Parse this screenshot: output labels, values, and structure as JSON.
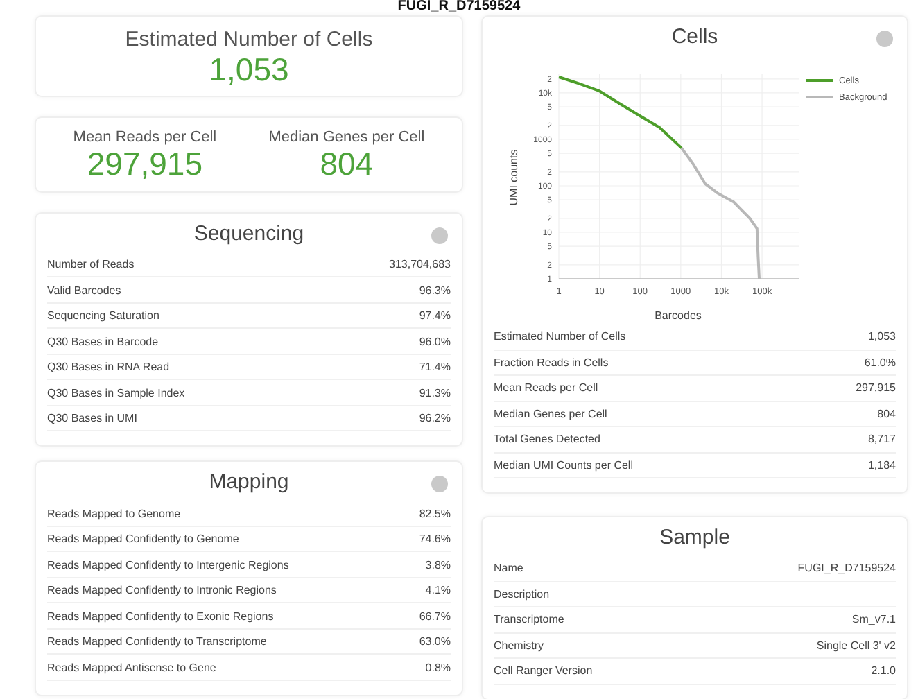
{
  "title": "FUGI_R_D7159524",
  "left_column": [
    {
      "kind": "metrics",
      "help": false,
      "metrics": [
        {
          "label": "Estimated Number of Cells",
          "value": "1,053"
        }
      ]
    },
    {
      "kind": "metrics",
      "help": false,
      "metrics": [
        {
          "label": "Mean Reads per Cell",
          "value": "297,915"
        },
        {
          "label": "Median Genes per Cell",
          "value": "804"
        }
      ]
    },
    {
      "kind": "table",
      "title": "Sequencing",
      "help": true,
      "rows": [
        {
          "label": "Number of Reads",
          "value": "313,704,683"
        },
        {
          "label": "Valid Barcodes",
          "value": "96.3%"
        },
        {
          "label": "Sequencing Saturation",
          "value": "97.4%"
        },
        {
          "label": "Q30 Bases in Barcode",
          "value": "96.0%"
        },
        {
          "label": "Q30 Bases in RNA Read",
          "value": "71.4%"
        },
        {
          "label": "Q30 Bases in Sample Index",
          "value": "91.3%"
        },
        {
          "label": "Q30 Bases in UMI",
          "value": "96.2%"
        }
      ]
    },
    {
      "kind": "table",
      "title": "Mapping",
      "help": true,
      "rows": [
        {
          "label": "Reads Mapped to Genome",
          "value": "82.5%"
        },
        {
          "label": "Reads Mapped Confidently to Genome",
          "value": "74.6%"
        },
        {
          "label": "Reads Mapped Confidently to Intergenic Regions",
          "value": "3.8%"
        },
        {
          "label": "Reads Mapped Confidently to Intronic Regions",
          "value": "4.1%"
        },
        {
          "label": "Reads Mapped Confidently to Exonic Regions",
          "value": "66.7%"
        },
        {
          "label": "Reads Mapped Confidently to Transcriptome",
          "value": "63.0%"
        },
        {
          "label": "Reads Mapped Antisense to Gene",
          "value": "0.8%"
        }
      ]
    }
  ],
  "right_column": [
    {
      "kind": "table",
      "title": "Cells",
      "help": true,
      "plot": {
        "xlabel": "Barcodes",
        "ylabel": "UMI counts",
        "x_tick_labels": [
          "1",
          "10",
          "100",
          "1000",
          "10k",
          "100k"
        ],
        "y_tick_labels": [
          "2",
          "10k",
          "5",
          "2",
          "1000",
          "5",
          "2",
          "100",
          "5",
          "2",
          "10",
          "5",
          "2",
          "1"
        ],
        "legend": [
          {
            "name": "Cells",
            "color": "#4d9e2a"
          },
          {
            "name": "Background",
            "color": "#b8b8b8"
          }
        ]
      },
      "rows": [
        {
          "label": "Estimated Number of Cells",
          "value": "1,053"
        },
        {
          "label": "Fraction Reads in Cells",
          "value": "61.0%"
        },
        {
          "label": "Mean Reads per Cell",
          "value": "297,915"
        },
        {
          "label": "Median Genes per Cell",
          "value": "804"
        },
        {
          "label": "Total Genes Detected",
          "value": "8,717"
        },
        {
          "label": "Median UMI Counts per Cell",
          "value": "1,184"
        }
      ]
    },
    {
      "kind": "table",
      "title": "Sample",
      "help": false,
      "rows": [
        {
          "label": "Name",
          "value": "FUGI_R_D7159524"
        },
        {
          "label": "Description"
        },
        {
          "label": "Transcriptome",
          "value": "Sm_v7.1"
        },
        {
          "label": "Chemistry",
          "value": "Single Cell 3' v2"
        },
        {
          "label": "Cell Ranger Version",
          "value": "2.1.0"
        }
      ]
    }
  ]
}
